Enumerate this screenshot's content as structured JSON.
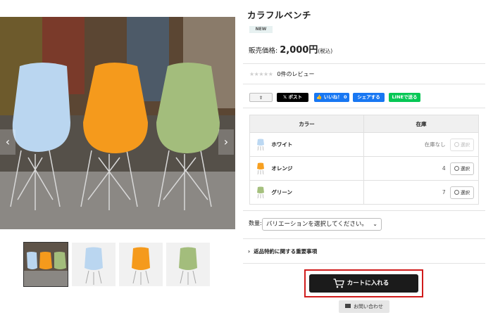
{
  "product": {
    "title": "カラフルベンチ",
    "badge": "NEW",
    "price_label": "販売価格:",
    "price_value": "2,000円",
    "price_tax": "(税込)",
    "review_stars": "★★★★★",
    "review_text": "0件のレビュー"
  },
  "gallery": {
    "prev_arrow": "‹",
    "next_arrow": "›",
    "thumbnail_count": 4
  },
  "share": {
    "copy_label": "⇪",
    "x_label": "𝕏 ポスト",
    "fb_like_label": "👍 いいね！ 0",
    "fb_share_label": "シェアする",
    "line_label": "LINEで送る"
  },
  "variants": {
    "col_color": "カラー",
    "col_stock": "在庫",
    "rows": [
      {
        "name": "ホワイト",
        "stock": "在庫なし",
        "select": "選択",
        "available": false,
        "color": "#bcd8f2"
      },
      {
        "name": "オレンジ",
        "stock": "4",
        "select": "選択",
        "available": true,
        "color": "#f7a021"
      },
      {
        "name": "グリーン",
        "stock": "7",
        "select": "選択",
        "available": true,
        "color": "#a5c07e"
      }
    ]
  },
  "quantity": {
    "label": "数量:",
    "select_value": "バリエーションを選択してください。"
  },
  "returns": {
    "label": "返品特約に関する重要事項"
  },
  "actions": {
    "cart_label": "カートに入れる",
    "contact_label": "お問い合わせ"
  },
  "colors": {
    "highlight_border": "#d01c1c",
    "cart_bg": "#1b1b1b"
  }
}
